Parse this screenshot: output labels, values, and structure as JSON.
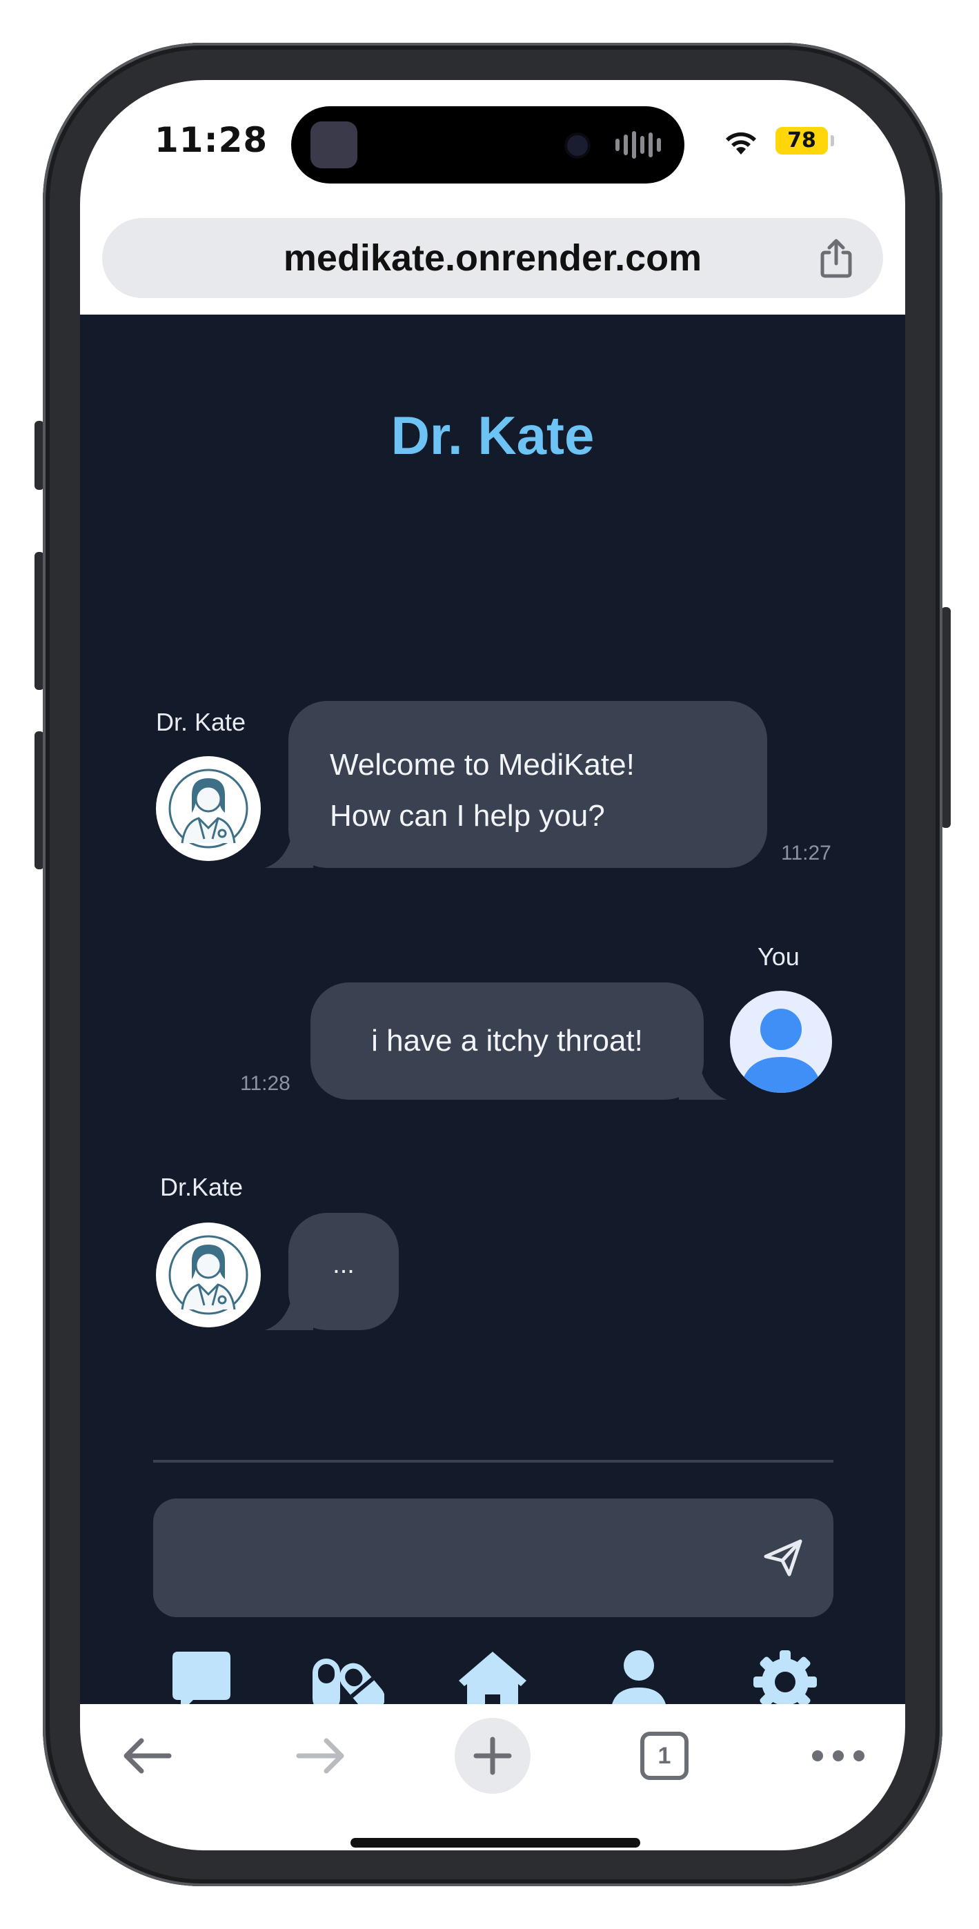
{
  "status_bar": {
    "time": "11:28",
    "battery": "78"
  },
  "browser": {
    "url": "medikate.onrender.com",
    "tab_count": "1"
  },
  "app": {
    "title": "Dr. Kate",
    "accent_color": "#6ec3f5",
    "background_color": "#131a29",
    "bubble_color": "#3a4252"
  },
  "chat": {
    "messages": [
      {
        "sender": "Dr. Kate",
        "lines": [
          "Welcome to MediKate!",
          "How can I help you?"
        ],
        "time": "11:27",
        "avatar": "doctor-avatar"
      },
      {
        "sender": "You",
        "lines": [
          "i have a itchy throat!"
        ],
        "time": "11:28",
        "avatar": "user-avatar"
      },
      {
        "sender": "Dr.Kate",
        "lines": [
          "..."
        ],
        "avatar": "doctor-avatar"
      }
    ]
  },
  "input": {
    "placeholder": ""
  },
  "nav": {
    "icons": [
      "chat-icon",
      "pills-icon",
      "home-icon",
      "user-icon",
      "gear-icon"
    ]
  },
  "toolbar": {
    "icons": [
      "back-arrow-icon",
      "forward-arrow-icon",
      "new-tab-plus-icon",
      "tabs-icon",
      "more-icon"
    ]
  }
}
